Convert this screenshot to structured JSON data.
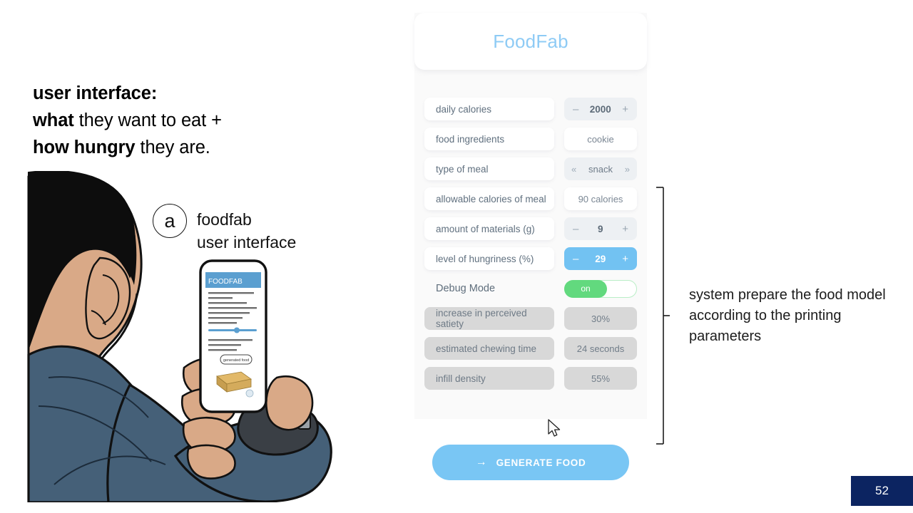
{
  "headline": {
    "line1_bold": "user interface:",
    "line2_bold": "what",
    "line2_rest": " they want to eat +",
    "line3_bold": "how hungry",
    "line3_rest": " they are."
  },
  "caption": {
    "marker": "a",
    "line1": "foodfab",
    "line2": "user interface"
  },
  "app": {
    "title": "FoodFab",
    "rows": [
      {
        "label": "daily calories",
        "value": "2000",
        "kind": "stepper",
        "minus": "–",
        "plus": "+"
      },
      {
        "label": "food ingredients",
        "value": "cookie",
        "kind": "plain"
      },
      {
        "label": "type of meal",
        "value": "snack",
        "kind": "chooser",
        "prev": "«",
        "next": "»"
      },
      {
        "label": "allowable calories of meal",
        "value": "90 calories",
        "kind": "plain"
      },
      {
        "label": "amount of materials (g)",
        "value": "9",
        "kind": "stepper",
        "minus": "–",
        "plus": "+"
      },
      {
        "label": "level of hungriness (%)",
        "value": "29",
        "kind": "stepper-active",
        "minus": "–",
        "plus": "+"
      }
    ],
    "debug": {
      "label": "Debug Mode",
      "toggle_state": "on"
    },
    "debug_rows": [
      {
        "label": "increase in perceived satiety",
        "value": "30%"
      },
      {
        "label": "estimated chewing time",
        "value": "24 seconds"
      },
      {
        "label": "infill density",
        "value": "55%"
      }
    ],
    "generate_button": {
      "arrow": "→",
      "label": "GENERATE FOOD"
    }
  },
  "phone_screen": {
    "header": "FOODFAB",
    "button": "generated food"
  },
  "annotation": {
    "text": "system prepare the food model according to the printing parameters"
  },
  "footer": {
    "page_number": "52"
  },
  "colors": {
    "accent_blue": "#79c6f4",
    "title_blue": "#8ecbf5",
    "toggle_green": "#62d97e",
    "panel_bg": "#fafafa",
    "label_text": "#60707f",
    "muted_row": "#d8d8d8",
    "page_badge": "#0c2461",
    "shirt_blue": "#456078",
    "skin": "#d9a987",
    "hair": "#0d0d0d"
  }
}
